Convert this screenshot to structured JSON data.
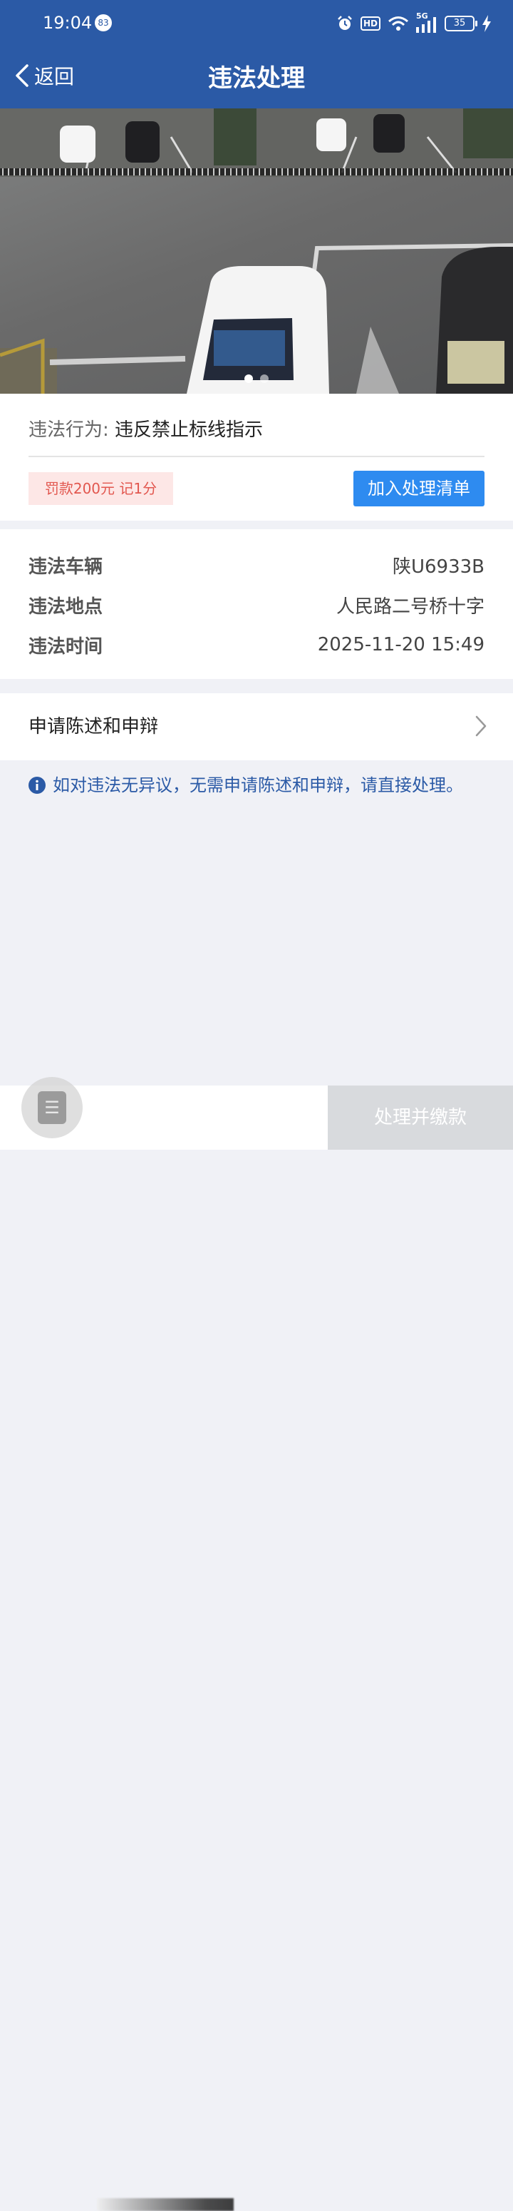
{
  "status_bar": {
    "time": "19:04",
    "notification_count": "83",
    "hd_label": "HD",
    "network": "5G",
    "battery": "35"
  },
  "header": {
    "back_label": "返回",
    "title": "违法处理"
  },
  "photo": {
    "slide_count": 2,
    "active_index": 0
  },
  "violation": {
    "behavior_label": "违法行为:",
    "behavior_value": "违反禁止标线指示",
    "fine_tag": "罚款200元 记1分",
    "add_button": "加入处理清单"
  },
  "details": [
    {
      "label": "违法车辆",
      "value": "陕U6933B"
    },
    {
      "label": "违法地点",
      "value": "人民路二号桥十字"
    },
    {
      "label": "违法时间",
      "value": "2025-11-20 15:49"
    }
  ],
  "appeal": {
    "label": "申请陈述和申辩"
  },
  "notice": {
    "text": "如对违法无异议，无需申请陈述和申辩，请直接处理。"
  },
  "bottom": {
    "menu_glyph": "☰",
    "pay_button": "处理并缴款"
  },
  "colors": {
    "header_bg": "#2b5aa6",
    "primary_button": "#2e8bf0",
    "fine_tag_text": "#e2574f",
    "fine_tag_bg": "#fde7e6",
    "notice_text": "#2b5aa6",
    "disabled_button": "#d8dadd"
  }
}
